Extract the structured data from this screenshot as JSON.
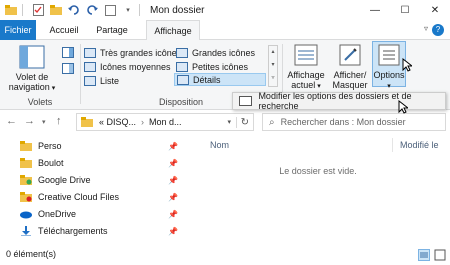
{
  "window": {
    "title": "Mon dossier",
    "minimize": "—",
    "maximize": "☐",
    "close": "✕"
  },
  "tabs": {
    "file": "Fichier",
    "home": "Accueil",
    "share": "Partage",
    "view": "Affichage",
    "help": "?"
  },
  "ribbon": {
    "panes": {
      "nav_pane_label": "Volet de navigation",
      "group": "Volets"
    },
    "layout": {
      "very_large": "Très grandes icônes",
      "large": "Grandes icônes",
      "medium": "Icônes moyennes",
      "small": "Petites icônes",
      "list": "Liste",
      "details": "Détails",
      "group": "Disposition"
    },
    "current_view": {
      "label": "Affichage actuel"
    },
    "show_hide": {
      "label": "Afficher/ Masquer"
    },
    "options": {
      "label": "Options"
    }
  },
  "dropdown": {
    "item": "Modifier les options des dossiers et de recherche"
  },
  "address": {
    "path_prefix": "«  DISQ...",
    "path_current": "Mon d...",
    "search_placeholder": "Rechercher dans : Mon dossier"
  },
  "nav": {
    "items": [
      {
        "label": "Perso"
      },
      {
        "label": "Boulot"
      },
      {
        "label": "Google Drive"
      },
      {
        "label": "Creative Cloud Files"
      },
      {
        "label": "OneDrive"
      },
      {
        "label": "Téléchargements"
      }
    ]
  },
  "content": {
    "col_name": "Nom",
    "col_modified": "Modifié le",
    "empty_message": "Le dossier est vide."
  },
  "status": {
    "text": "0 élément(s)"
  }
}
